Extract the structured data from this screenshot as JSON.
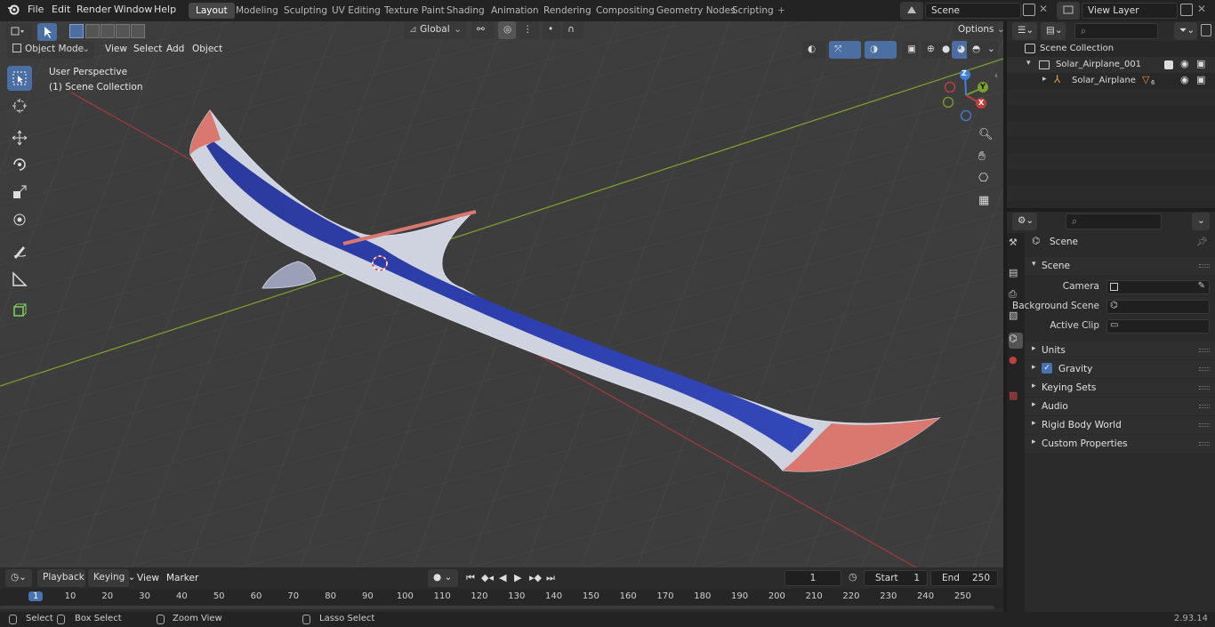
{
  "menu": {
    "file": "File",
    "edit": "Edit",
    "render": "Render",
    "window": "Window",
    "help": "Help"
  },
  "workspaces": [
    "Layout",
    "Modeling",
    "Sculpting",
    "UV Editing",
    "Texture Paint",
    "Shading",
    "Animation",
    "Rendering",
    "Compositing",
    "Geometry Nodes",
    "Scripting"
  ],
  "scene_field": "Scene",
  "view_layer_field": "View Layer",
  "viewport": {
    "mode": "Object Mode",
    "menus": {
      "view": "View",
      "select": "Select",
      "add": "Add",
      "object": "Object"
    },
    "transform_orientation": "Global",
    "options": "Options",
    "overlay_title": "User Perspective",
    "overlay_sub": "(1) Scene Collection",
    "gizmo": {
      "z": "Z",
      "y": "Y",
      "x": "X"
    }
  },
  "timeline": {
    "menus": {
      "playback": "Playback",
      "keying": "Keying",
      "view": "View",
      "marker": "Marker"
    },
    "current_frame": "1",
    "start_label": "Start",
    "start": "1",
    "end_label": "End",
    "end": "250",
    "ticks": [
      "1",
      "10",
      "20",
      "30",
      "40",
      "50",
      "60",
      "70",
      "80",
      "90",
      "100",
      "110",
      "120",
      "130",
      "140",
      "150",
      "160",
      "170",
      "180",
      "190",
      "200",
      "210",
      "220",
      "230",
      "240",
      "250"
    ]
  },
  "status": {
    "select": "Select",
    "box_select": "Box Select",
    "zoom_view": "Zoom View",
    "lasso_select": "Lasso Select",
    "version": "2.93.14"
  },
  "outliner": {
    "root": "Scene Collection",
    "collection": "Solar_Airplane_001",
    "object": "Solar_Airplane",
    "object_badge": "6"
  },
  "properties": {
    "context": "Scene",
    "panel_scene": "Scene",
    "camera_label": "Camera",
    "bg_scene_label": "Background Scene",
    "active_clip_label": "Active Clip",
    "panels": [
      "Units",
      "Gravity",
      "Keying Sets",
      "Audio",
      "Rigid Body World",
      "Custom Properties"
    ]
  },
  "colors": {
    "accent": "#4b6fa3",
    "active_frame": "#4772b3",
    "x_axis": "#c04040",
    "y_axis": "#7a9f2a",
    "z_axis": "#3f7fd6",
    "wing_blue": "#2a3ca8",
    "wing_tip": "#d9786e"
  }
}
